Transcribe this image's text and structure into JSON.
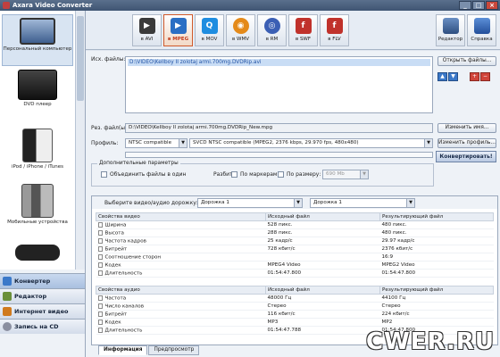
{
  "window": {
    "title": "Axara Video Converter"
  },
  "sidebar": {
    "devices": [
      {
        "label": "Персональный компьютер",
        "icon": "pc-icon"
      },
      {
        "label": "DVD плеер",
        "icon": "dvd-player-icon"
      },
      {
        "label": "iPod / iPhone / iTunes",
        "icon": "ipod-icon"
      },
      {
        "label": "Мобильные устройства",
        "icon": "mobile-phone-icon"
      },
      {
        "label": "",
        "icon": "psp-icon"
      }
    ],
    "nav": [
      {
        "label": "Конвертер",
        "icon": "converter-icon"
      },
      {
        "label": "Редактор",
        "icon": "editor-icon"
      },
      {
        "label": "Интернет видео",
        "icon": "internet-video-icon"
      },
      {
        "label": "Запись на CD",
        "icon": "cd-burn-icon"
      }
    ]
  },
  "toolbar": {
    "formats": [
      {
        "label": "в AVI",
        "glyph": "▶",
        "color": "#3a3a3a"
      },
      {
        "label": "в MPEG",
        "glyph": "▶",
        "color": "#2b6fc4"
      },
      {
        "label": "в MOV",
        "glyph": "Q",
        "color": "#1f8de0"
      },
      {
        "label": "в WMV",
        "glyph": "◉",
        "color": "#e48a1a"
      },
      {
        "label": "в RM",
        "glyph": "◎",
        "color": "#3b5fb4"
      },
      {
        "label": "в SWF",
        "glyph": "f",
        "color": "#c0322b"
      },
      {
        "label": "в FLV",
        "glyph": "f",
        "color": "#c0322b"
      }
    ],
    "editor_label": "Редактор",
    "help_label": "Справка"
  },
  "main": {
    "source_label": "Исх. файлы:",
    "source_files": [
      "D:\\VIDEO\\Kellboy II zolotaj armi.700mg.DVDRip.avi"
    ],
    "open_files_btn": "Открыть файлы...",
    "result_label": "Рез. файл(ы):",
    "result_value": "D:\\VIDEO\\Kellboy II zolotaj armi.700mg.DVDRip_New.mpg",
    "change_name_btn": "Изменить имя...",
    "profiles_label": "Профиль:",
    "profile_standard": "NTSC compatible",
    "profile_value": "SVCD NTSC compatible (MPEG2, 2376 kbps, 29.970 fps, 480x480)",
    "change_profile_btn": "Изменить профиль...",
    "convert_btn": "Конвертировать!",
    "extra_params_label": "Дополнительные параметры",
    "merge_label": "Объединить файлы в один",
    "split_label": "Разбить",
    "by_markers_label": "По маркерам",
    "by_size_label": "По размеру:",
    "size_value": "690 Mb",
    "track_label": "Выберите видео/аудио дорожку:",
    "video_track": "Дорожка 1",
    "audio_track": "Дорожка 1"
  },
  "video_table": {
    "headers": [
      "Свойства видео",
      "Исходный файл",
      "Результирующий файл"
    ],
    "rows": [
      [
        "Ширина",
        "528 пикс.",
        "480 пикс."
      ],
      [
        "Высота",
        "288 пикс.",
        "480 пикс."
      ],
      [
        "Частота кадров",
        "25 кадр/с",
        "29.97 кадр/с"
      ],
      [
        "Битрейт",
        "728 кбит/с",
        "2376 кбит/с"
      ],
      [
        "Соотношение сторон",
        "",
        "16:9"
      ],
      [
        "Кодек",
        "MPEG4 Video",
        "MPEG2 Video"
      ],
      [
        "Длительность",
        "01:54:47.800",
        "01:54:47.800"
      ]
    ]
  },
  "audio_table": {
    "headers": [
      "Свойства аудио",
      "Исходный файл",
      "Результирующий файл"
    ],
    "rows": [
      [
        "Частота",
        "48000 Гц",
        "44100 Гц"
      ],
      [
        "Число каналов",
        "Стерео",
        "Стерео"
      ],
      [
        "Битрейт",
        "116 кбит/с",
        "224 кбит/с"
      ],
      [
        "Кодек",
        "MP3",
        "MP2"
      ],
      [
        "Длительность",
        "01:54:47.788",
        "01:54:47.800"
      ]
    ]
  },
  "tabs": [
    "Информация",
    "Предпросмотр"
  ],
  "watermark": "CWER.RU"
}
